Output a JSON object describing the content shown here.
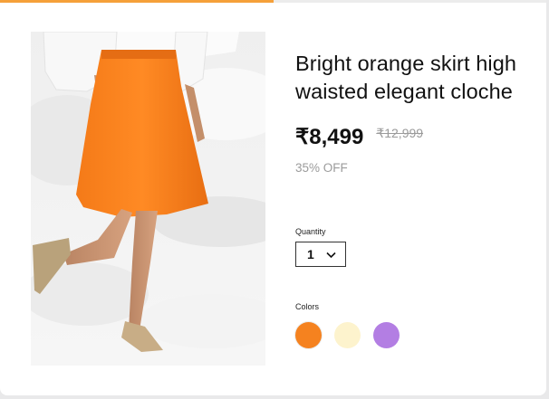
{
  "progress": {
    "fraction": 0.5,
    "color": "#f5a03a"
  },
  "product": {
    "title": "Bright orange skirt high waisted elegant cloche",
    "price": "₹8,499",
    "mrp": "₹12,999",
    "discount": "35% OFF"
  },
  "quantity": {
    "label": "Quantity",
    "selected": "1",
    "icon": "chevron-down-icon"
  },
  "colors": {
    "label": "Colors",
    "options": [
      {
        "name": "orange",
        "hex": "#f5821f",
        "selected": true
      },
      {
        "name": "cream",
        "hex": "#fdf3cd",
        "selected": false
      },
      {
        "name": "lavender",
        "hex": "#b37ee3",
        "selected": false
      }
    ]
  }
}
